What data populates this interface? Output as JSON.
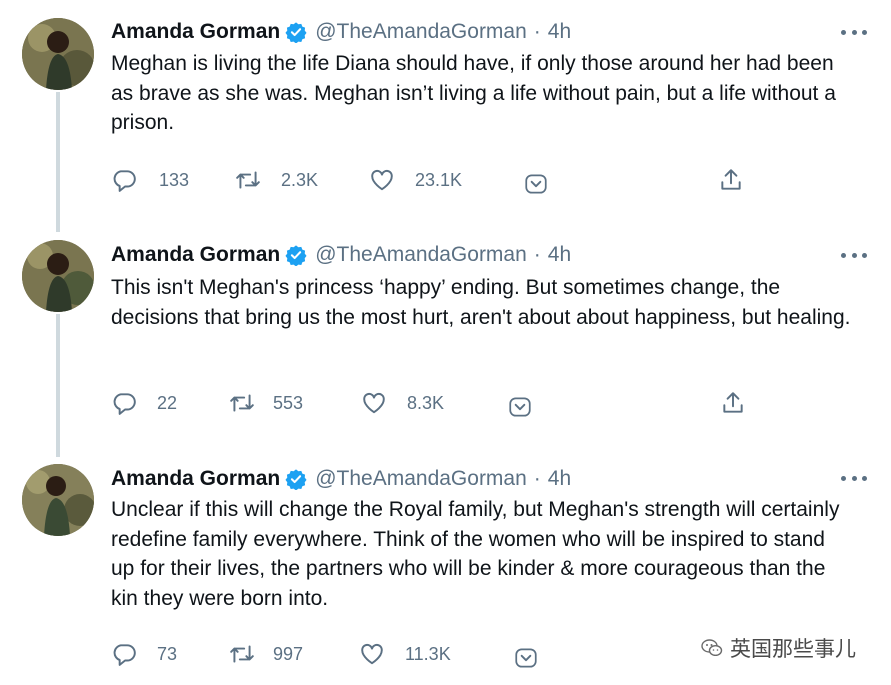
{
  "tweets": [
    {
      "name": "Amanda Gorman",
      "handle": "@TheAmandaGorman",
      "separator": "·",
      "time": "4h",
      "text": "Meghan is living the life Diana should have, if only those around her had been as brave as she was. Meghan isn’t living a life without pain, but a life without a prison.",
      "replies": "133",
      "retweets": "2.3K",
      "likes": "23.1K"
    },
    {
      "name": "Amanda Gorman",
      "handle": "@TheAmandaGorman",
      "separator": "·",
      "time": "4h",
      "text": "This isn't Meghan's princess ‘happy’ ending. But sometimes change, the decisions that bring us the most hurt, aren't about about happiness, but healing.",
      "replies": "22",
      "retweets": "553",
      "likes": "8.3K"
    },
    {
      "name": "Amanda Gorman",
      "handle": "@TheAmandaGorman",
      "separator": "·",
      "time": "4h",
      "text": "Unclear if this will change the Royal family, but Meghan's strength will certainly redefine family everywhere. Think of the women who will be inspired to stand up for their lives, the partners who will be kinder & more courageous than the kin they were born into.",
      "replies": "73",
      "retweets": "997",
      "likes": "11.3K"
    }
  ],
  "watermark": {
    "text": "英国那些事儿"
  },
  "icons": {
    "reply": "reply-icon",
    "retweet": "retweet-icon",
    "like": "heart-icon",
    "tip": "tip-jar-icon",
    "share": "share-icon",
    "verified": "verified-badge-icon",
    "more": "more-icon"
  },
  "colors": {
    "verified": "#1da1f2",
    "secondary_text": "#5b7083",
    "thread_line": "#cfd9de"
  }
}
